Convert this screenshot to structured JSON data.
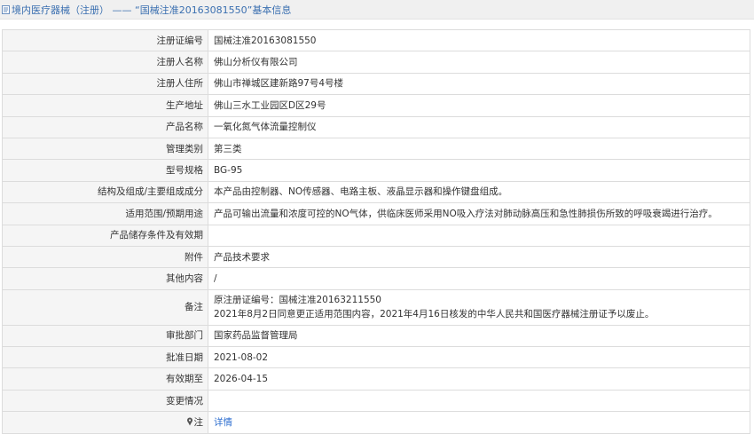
{
  "header": {
    "title": "境内医疗器械（注册） —— “国械注准20163081550”基本信息"
  },
  "rows": [
    {
      "label": "注册证编号",
      "value": "国械注准20163081550"
    },
    {
      "label": "注册人名称",
      "value": "佛山分析仪有限公司"
    },
    {
      "label": "注册人住所",
      "value": "佛山市禅城区建新路97号4号楼"
    },
    {
      "label": "生产地址",
      "value": "佛山三水工业园区D区29号"
    },
    {
      "label": "产品名称",
      "value": "一氧化氮气体流量控制仪"
    },
    {
      "label": "管理类别",
      "value": "第三类"
    },
    {
      "label": "型号规格",
      "value": "BG-95"
    },
    {
      "label": "结构及组成/主要组成成分",
      "value": "本产品由控制器、NO传感器、电路主板、液晶显示器和操作键盘组成。"
    },
    {
      "label": "适用范围/预期用途",
      "value": "产品可输出流量和浓度可控的NO气体，供临床医师采用NO吸入疗法对肺动脉高压和急性肺损伤所致的呼吸衰竭进行治疗。"
    },
    {
      "label": "产品储存条件及有效期",
      "value": ""
    },
    {
      "label": "附件",
      "value": "产品技术要求"
    },
    {
      "label": "其他内容",
      "value": "/"
    }
  ],
  "remark": {
    "label": "备注",
    "line1": "原注册证编号：国械注准20163211550",
    "line2": "2021年8月2日同意更正适用范围内容，2021年4月16日核发的中华人民共和国医疗器械注册证予以废止。"
  },
  "rows2": [
    {
      "label": "审批部门",
      "value": "国家药品监督管理局"
    },
    {
      "label": "批准日期",
      "value": "2021-08-02"
    },
    {
      "label": "有效期至",
      "value": "2026-04-15"
    },
    {
      "label": "变更情况",
      "value": ""
    }
  ],
  "note": {
    "label": "注",
    "link": "详情"
  },
  "colors": {
    "title": "#3a6fb0",
    "link": "#2f6fd0",
    "label_bg": "#f5f5f5",
    "border": "#dcdcdc"
  }
}
